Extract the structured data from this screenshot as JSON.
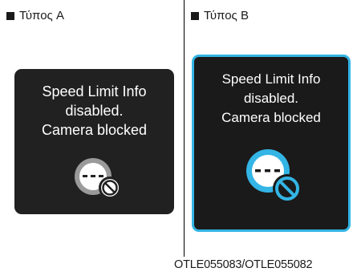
{
  "panel_a": {
    "type_label": "Τύπος A",
    "message": {
      "line1": "Speed Limit Info",
      "line2": "disabled.",
      "line3": "Camera blocked"
    },
    "icon": "speed-limit-camera-blocked-icon"
  },
  "panel_b": {
    "type_label": "Τύπος B",
    "message": {
      "line1": "Speed Limit Info",
      "line2": "disabled.",
      "line3": "Camera blocked"
    },
    "icon": "speed-limit-camera-blocked-icon"
  },
  "caption": "OTLE055083/OTLE055082",
  "colors": {
    "display_a_background": "#212121",
    "display_b_background": "#1a1a1a",
    "display_b_accent": "#33b5e5",
    "text_on_display": "#ffffff"
  }
}
